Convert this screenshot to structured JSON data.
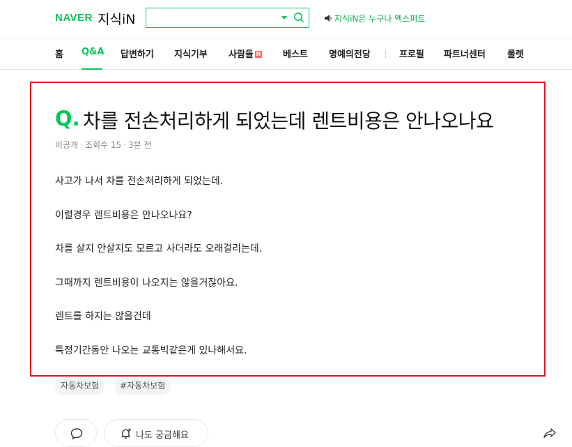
{
  "header": {
    "naver_logo": "NAVER",
    "service_name": "지식iN",
    "search": {
      "value": "",
      "placeholder": ""
    },
    "promo_text": "지식iN은 누구나 엑스퍼트",
    "brand_color": "#03c75a"
  },
  "nav": {
    "items": [
      "홈",
      "Q&A",
      "답변하기",
      "지식기부",
      "사람들",
      "베스트",
      "명예의전당",
      "프로필",
      "파트너센터",
      "롤렛"
    ],
    "active": "Q&A",
    "new_badge": "N"
  },
  "question": {
    "q_mark": "Q.",
    "title": "차를 전손처리하게 되었는데 렌트비용은 안나오나요",
    "meta": {
      "visibility": "비공개",
      "views": "조회수 15",
      "time": "3분 전"
    },
    "body": [
      "사고가 나서 차를 전손처리하게 되었는데.",
      "이럴경우 렌트비용은 안나오나요?",
      "차를 살지 안살지도 모르고 사더라도 오래걸리는데.",
      "그때까지 렌트비용이 나오지는 않을거잖아요.",
      "렌트를 하지는 않을건데",
      "특정기간동안 나오는 교통빅같은게 있나해서요."
    ]
  },
  "tags": [
    "자동차보험",
    "#자동차보험"
  ],
  "actions": {
    "curious_label": "나도 궁금해요"
  },
  "highlight_color": "#e0141e"
}
